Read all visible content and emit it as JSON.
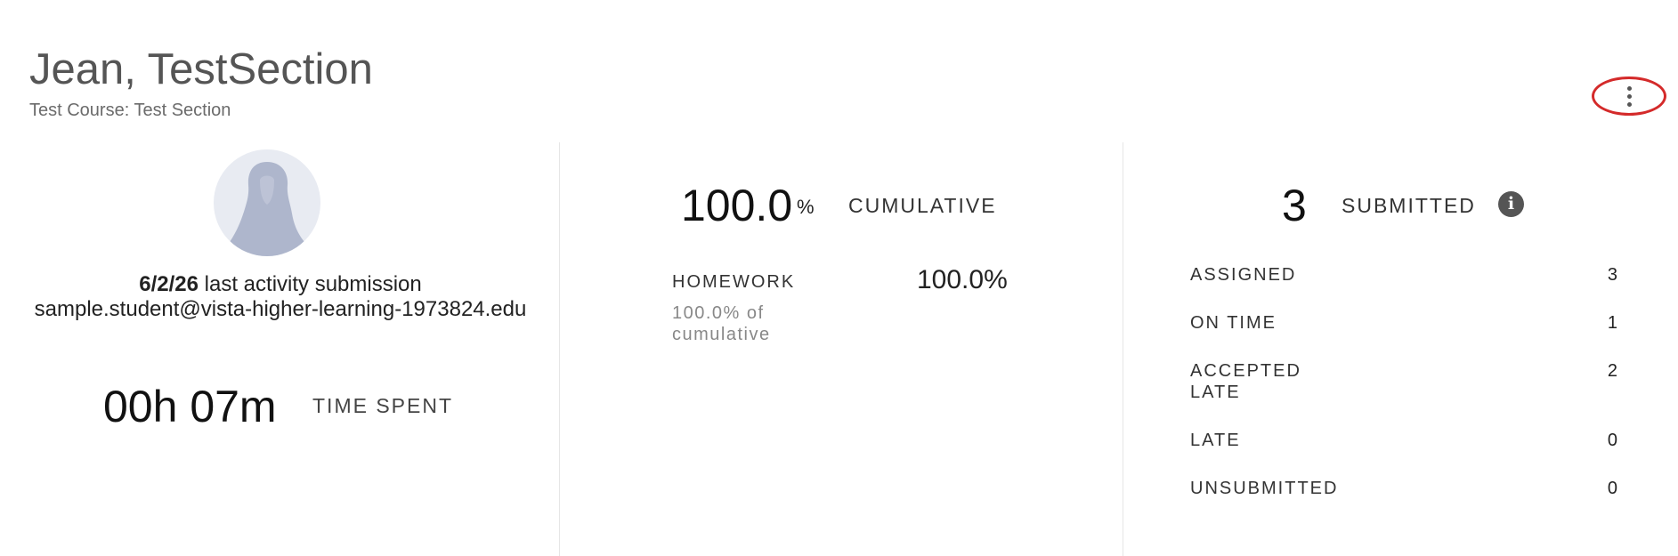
{
  "header": {
    "student_name": "Jean, TestSection",
    "course": "Test Course: Test Section",
    "menu_icon": "more-vertical-icon"
  },
  "profile": {
    "avatar_icon": "user-silhouette-icon",
    "last_activity_date": "6/2/26",
    "last_activity_label": "last activity submission",
    "email": "sample.student@vista-higher-learning-1973824.edu",
    "time_spent": "00h 07m",
    "time_spent_label": "TIME SPENT"
  },
  "grades": {
    "cumulative_value": "100.0",
    "cumulative_unit": "%",
    "cumulative_label": "CUMULATIVE",
    "categories": [
      {
        "label": "HOMEWORK",
        "sub": "100.0% of cumulative",
        "value": "100.0%"
      }
    ]
  },
  "submissions": {
    "count": "3",
    "label": "SUBMITTED",
    "info_icon": "info-icon",
    "stats": [
      {
        "label": "ASSIGNED",
        "value": "3"
      },
      {
        "label": "ON TIME",
        "value": "1"
      },
      {
        "label": "ACCEPTED LATE",
        "value": "2"
      },
      {
        "label": "LATE",
        "value": "0"
      },
      {
        "label": "UNSUBMITTED",
        "value": "0"
      }
    ]
  },
  "colors": {
    "highlight_ring": "#d42a2a",
    "avatar_background": "#e8ebf2",
    "avatar_figure": "#aeb6cc"
  }
}
